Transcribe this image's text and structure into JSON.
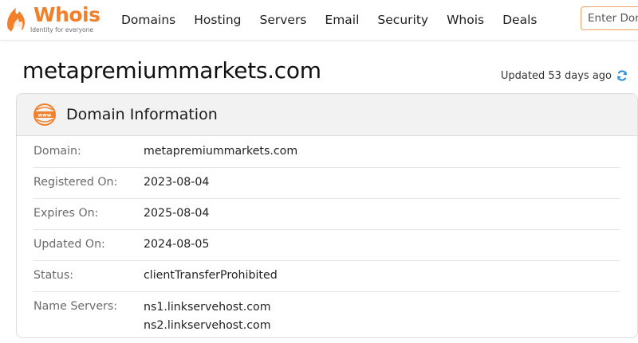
{
  "brand": {
    "name": "Whois",
    "tagline": "Identity for everyone",
    "accent_color": "#f27f29",
    "icon": "whois-flame-logo"
  },
  "nav": {
    "items": [
      {
        "label": "Domains"
      },
      {
        "label": "Hosting"
      },
      {
        "label": "Servers"
      },
      {
        "label": "Email"
      },
      {
        "label": "Security"
      },
      {
        "label": "Whois"
      },
      {
        "label": "Deals"
      }
    ]
  },
  "search": {
    "placeholder": "Enter Domain or IP",
    "value": ""
  },
  "page": {
    "title": "metapremiummarkets.com",
    "updated_text": "Updated 53 days ago",
    "refresh_icon": "refresh-icon",
    "refresh_color": "#2a8cd8"
  },
  "card": {
    "title": "Domain Information",
    "icon": "www-icon",
    "rows": [
      {
        "label": "Domain:",
        "value": "metapremiummarkets.com"
      },
      {
        "label": "Registered On:",
        "value": "2023-08-04"
      },
      {
        "label": "Expires On:",
        "value": "2025-08-04"
      },
      {
        "label": "Updated On:",
        "value": "2024-08-05"
      },
      {
        "label": "Status:",
        "value": "clientTransferProhibited"
      },
      {
        "label": "Name Servers:",
        "values": [
          "ns1.linkservehost.com",
          "ns2.linkservehost.com"
        ]
      }
    ]
  }
}
